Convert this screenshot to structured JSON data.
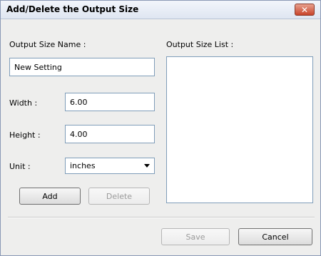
{
  "dialog": {
    "title": "Add/Delete the Output Size",
    "close_glyph": "✕"
  },
  "form": {
    "name_label": "Output Size Name :",
    "name_value": "New Setting",
    "width_label": "Width :",
    "width_value": "6.00",
    "height_label": "Height :",
    "height_value": "4.00",
    "unit_label": "Unit :",
    "unit_value": "inches"
  },
  "list": {
    "label": "Output Size List :"
  },
  "buttons": {
    "add": "Add",
    "delete": "Delete",
    "save": "Save",
    "cancel": "Cancel"
  },
  "state": {
    "delete_enabled": false,
    "save_enabled": false
  }
}
